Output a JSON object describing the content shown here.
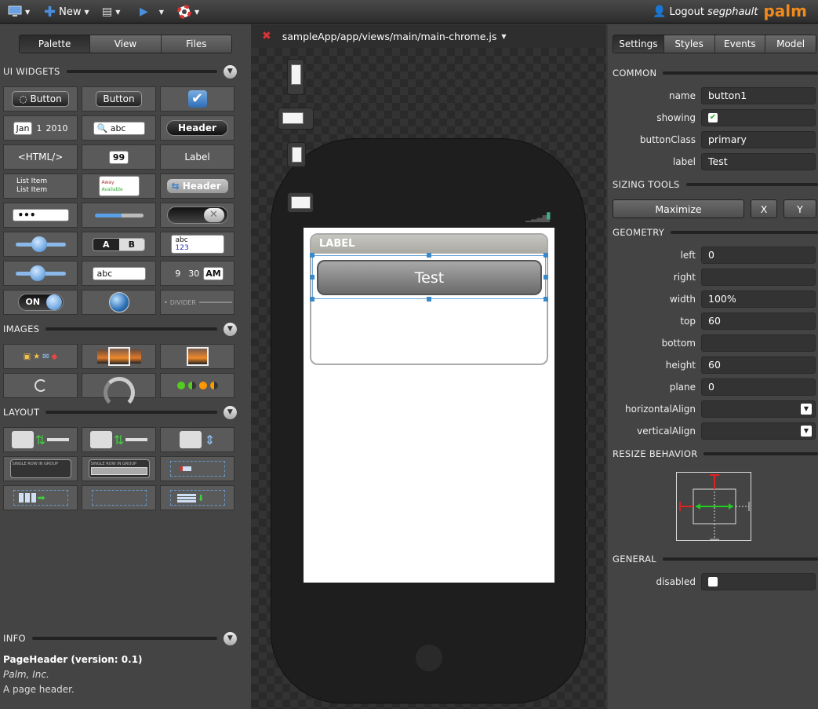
{
  "topbar": {
    "new_label": "New",
    "logout_label": "Logout",
    "username": "segphault",
    "brand": "palm"
  },
  "left": {
    "tabs": [
      "Palette",
      "View",
      "Files"
    ],
    "sections": {
      "ui_widgets": "UI WIDGETS",
      "images": "IMAGES",
      "layout": "LAYOUT",
      "info": "INFO"
    },
    "widgets": {
      "button1": "Button",
      "button2": "Button",
      "date_month": "Jan",
      "date_day": "1",
      "date_year": "2010",
      "search_text": "abc",
      "header": "Header",
      "html": "<HTML/>",
      "number": "99",
      "label": "Label",
      "list_item1": "List Item",
      "list_item2": "List Item",
      "away": "Away",
      "available": "Available",
      "header2": "Header",
      "password": "•••",
      "radio_a": "A",
      "radio_b": "B",
      "rich_abc": "abc",
      "rich_123": "123",
      "text_abc": "abc",
      "time_h": "9",
      "time_m": "30",
      "time_ampm": "AM",
      "toggle_on": "ON",
      "divider": "DIVIDER",
      "single_row1": "SINGLE ROW IN GROUP",
      "single_row2": "SINGLE ROW IN GROUP"
    },
    "info": {
      "title": "PageHeader (version: 0.1)",
      "vendor": "Palm, Inc.",
      "description": "A page header."
    }
  },
  "center": {
    "file_path": "sampleApp/app/views/main/main-chrome.js",
    "group_label": "LABEL",
    "button_text": "Test"
  },
  "right": {
    "tabs": [
      "Settings",
      "Styles",
      "Events",
      "Model"
    ],
    "common": {
      "heading": "COMMON",
      "name_k": "name",
      "name_v": "button1",
      "showing_k": "showing",
      "buttonClass_k": "buttonClass",
      "buttonClass_v": "primary",
      "label_k": "label",
      "label_v": "Test"
    },
    "sizing": {
      "heading": "SIZING TOOLS",
      "maximize": "Maximize",
      "x": "X",
      "y": "Y"
    },
    "geometry": {
      "heading": "GEOMETRY",
      "left_k": "left",
      "left_v": "0",
      "right_k": "right",
      "right_v": "",
      "width_k": "width",
      "width_v": "100%",
      "top_k": "top",
      "top_v": "60",
      "bottom_k": "bottom",
      "bottom_v": "",
      "height_k": "height",
      "height_v": "60",
      "plane_k": "plane",
      "plane_v": "0",
      "halign_k": "horizontalAlign",
      "halign_v": "",
      "valign_k": "verticalAlign",
      "valign_v": ""
    },
    "resize": {
      "heading": "RESIZE BEHAVIOR"
    },
    "general": {
      "heading": "GENERAL",
      "disabled_k": "disabled"
    }
  }
}
